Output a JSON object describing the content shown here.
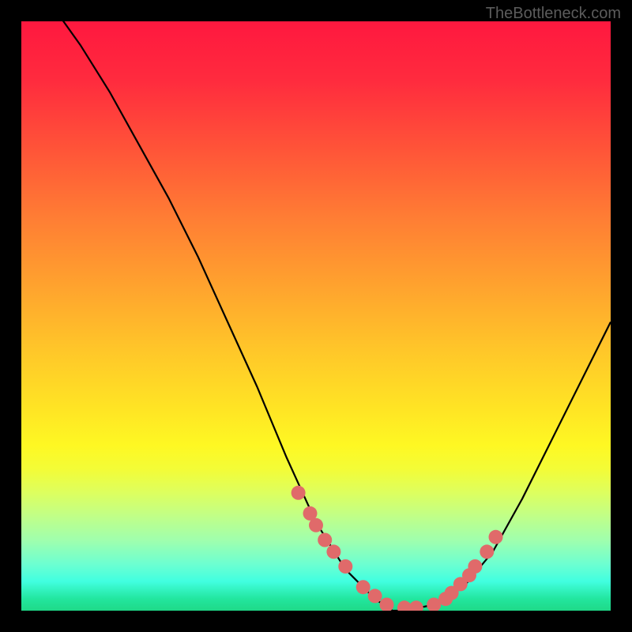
{
  "watermark": "TheBottleneck.com",
  "chart_data": {
    "type": "line",
    "title": "",
    "xlabel": "",
    "ylabel": "",
    "xlim": [
      0,
      100
    ],
    "ylim": [
      0,
      100
    ],
    "series": [
      {
        "name": "bottleneck-curve",
        "x": [
          0,
          5,
          10,
          15,
          20,
          25,
          30,
          35,
          40,
          45,
          50,
          55,
          60,
          63,
          65,
          70,
          75,
          80,
          85,
          90,
          95,
          100
        ],
        "y": [
          110,
          103,
          96,
          88,
          79,
          70,
          60,
          49,
          38,
          26,
          15,
          7,
          2,
          0,
          0,
          1,
          4,
          10,
          19,
          29,
          39,
          49
        ]
      }
    ],
    "markers": {
      "name": "highlight-points",
      "x": [
        47,
        49,
        50,
        51.5,
        53,
        55,
        58,
        60,
        62,
        65,
        67,
        70,
        72,
        73,
        74.5,
        76,
        77,
        79,
        80.5
      ],
      "y": [
        20,
        16.5,
        14.5,
        12,
        10,
        7.5,
        4,
        2.5,
        1,
        0.5,
        0.5,
        1,
        2,
        3,
        4.5,
        6,
        7.5,
        10,
        12.5
      ]
    },
    "gradient_stops": [
      {
        "pos": 0,
        "color": "#ff183f"
      },
      {
        "pos": 50,
        "color": "#ffc729"
      },
      {
        "pos": 75,
        "color": "#fef823"
      },
      {
        "pos": 100,
        "color": "#1fd988"
      }
    ]
  }
}
